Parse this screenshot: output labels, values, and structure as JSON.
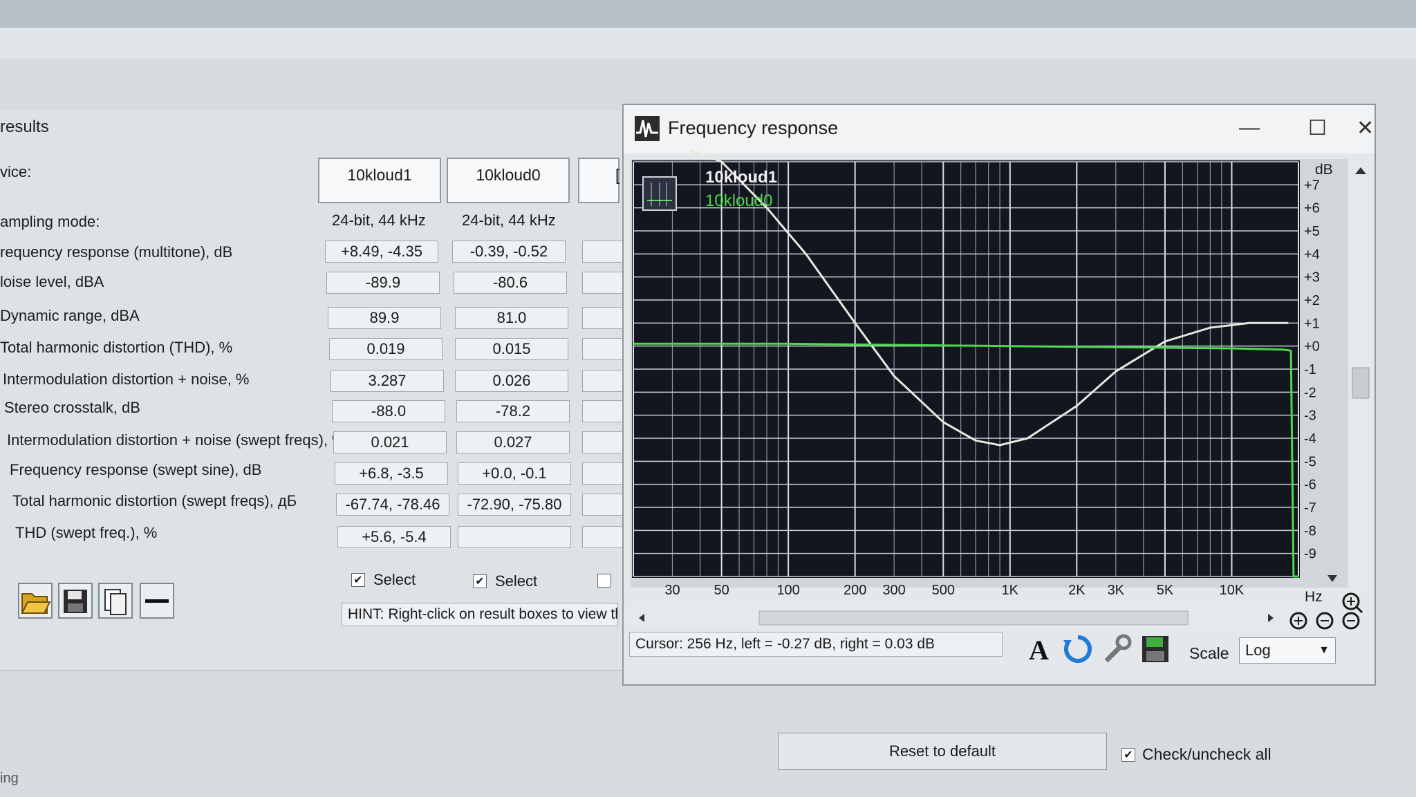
{
  "results": {
    "title": "results",
    "device_label": "vice:",
    "columns": [
      "10kloud1",
      "10kloud0"
    ],
    "third_col_glyph": "[",
    "rows": [
      {
        "label": "ampling mode:",
        "values": [
          "24-bit, 44 kHz",
          "24-bit, 44 kHz"
        ]
      },
      {
        "label": "requency response (multitone), dB",
        "values": [
          "+8.49, -4.35",
          "-0.39, -0.52"
        ]
      },
      {
        "label": "loise level, dBA",
        "values": [
          "-89.9",
          "-80.6"
        ]
      },
      {
        "label": "Dynamic range, dBA",
        "values": [
          "89.9",
          "81.0"
        ]
      },
      {
        "label": "Total harmonic distortion (THD), %",
        "values": [
          "0.019",
          "0.015"
        ]
      },
      {
        "label": "Intermodulation distortion + noise, %",
        "values": [
          "3.287",
          "0.026"
        ]
      },
      {
        "label": "Stereo crosstalk, dB",
        "values": [
          "-88.0",
          "-78.2"
        ]
      },
      {
        "label": "Intermodulation distortion + noise (swept freqs), %",
        "values": [
          "0.021",
          "0.027"
        ]
      },
      {
        "label": "Frequency response (swept sine), dB",
        "values": [
          "+6.8, -3.5",
          "+0.0, -0.1"
        ]
      },
      {
        "label": "Total harmonic distortion (swept freqs), дБ",
        "values": [
          "-67.74, -78.46",
          "-72.90, -75.80"
        ]
      },
      {
        "label": "THD (swept freq.), %",
        "values": [
          "+5.6, -5.4",
          ""
        ]
      }
    ],
    "select_label": "Select",
    "select_checked": [
      "✔",
      "✔"
    ],
    "hint": "HINT: Right-click on result boxes to view th"
  },
  "fr_window": {
    "title": "Frequency response",
    "minimize_glyph": "—",
    "maximize_glyph": "☐",
    "close_glyph": "✕",
    "cursor": "Cursor:  256 Hz,  left = -0.27 dB,  right = 0.03 dB",
    "scale_label": "Scale",
    "scale_value": "Log",
    "font_button_glyph": "A"
  },
  "chart_data": {
    "type": "line",
    "x_scale": "log",
    "xlim": [
      20,
      20000
    ],
    "ylim": [
      -10,
      8
    ],
    "xlabel": "Hz",
    "ylabel": "dB",
    "x_ticks": [
      {
        "v": 30,
        "label": "30"
      },
      {
        "v": 50,
        "label": "50"
      },
      {
        "v": 100,
        "label": "100"
      },
      {
        "v": 200,
        "label": "200"
      },
      {
        "v": 300,
        "label": "300"
      },
      {
        "v": 500,
        "label": "500"
      },
      {
        "v": 1000,
        "label": "1K"
      },
      {
        "v": 2000,
        "label": "2K"
      },
      {
        "v": 3000,
        "label": "3K"
      },
      {
        "v": 5000,
        "label": "5K"
      },
      {
        "v": 10000,
        "label": "10K"
      }
    ],
    "y_ticks": [
      {
        "v": 7,
        "label": "+7"
      },
      {
        "v": 6,
        "label": "+6"
      },
      {
        "v": 5,
        "label": "+5"
      },
      {
        "v": 4,
        "label": "+4"
      },
      {
        "v": 3,
        "label": "+3"
      },
      {
        "v": 2,
        "label": "+2"
      },
      {
        "v": 1,
        "label": "+1"
      },
      {
        "v": 0,
        "label": "+0"
      },
      {
        "v": -1,
        "label": "-1"
      },
      {
        "v": -2,
        "label": "-2"
      },
      {
        "v": -3,
        "label": "-3"
      },
      {
        "v": -4,
        "label": "-4"
      },
      {
        "v": -5,
        "label": "-5"
      },
      {
        "v": -6,
        "label": "-6"
      },
      {
        "v": -7,
        "label": "-7"
      },
      {
        "v": -8,
        "label": "-8"
      },
      {
        "v": -9,
        "label": "-9"
      }
    ],
    "grid": true,
    "legend_position": "top-left",
    "series": [
      {
        "name": "10kloud1",
        "color": "#e8e8e0",
        "x": [
          36,
          50,
          80,
          120,
          200,
          300,
          500,
          700,
          900,
          1200,
          2000,
          3000,
          5000,
          8000,
          12000,
          18000
        ],
        "y": [
          8.5,
          8.0,
          6.0,
          4.0,
          1.0,
          -1.3,
          -3.3,
          -4.1,
          -4.3,
          -4.0,
          -2.6,
          -1.1,
          0.2,
          0.8,
          1.0,
          1.0
        ]
      },
      {
        "name": "10kloud0",
        "color": "#4dd84d",
        "x": [
          20,
          50,
          100,
          300,
          1000,
          3000,
          10000,
          17000,
          18500,
          19000,
          20000
        ],
        "y": [
          0.1,
          0.1,
          0.1,
          0.05,
          0.0,
          -0.05,
          -0.1,
          -0.15,
          -0.2,
          -10,
          -10
        ]
      }
    ]
  }
}
